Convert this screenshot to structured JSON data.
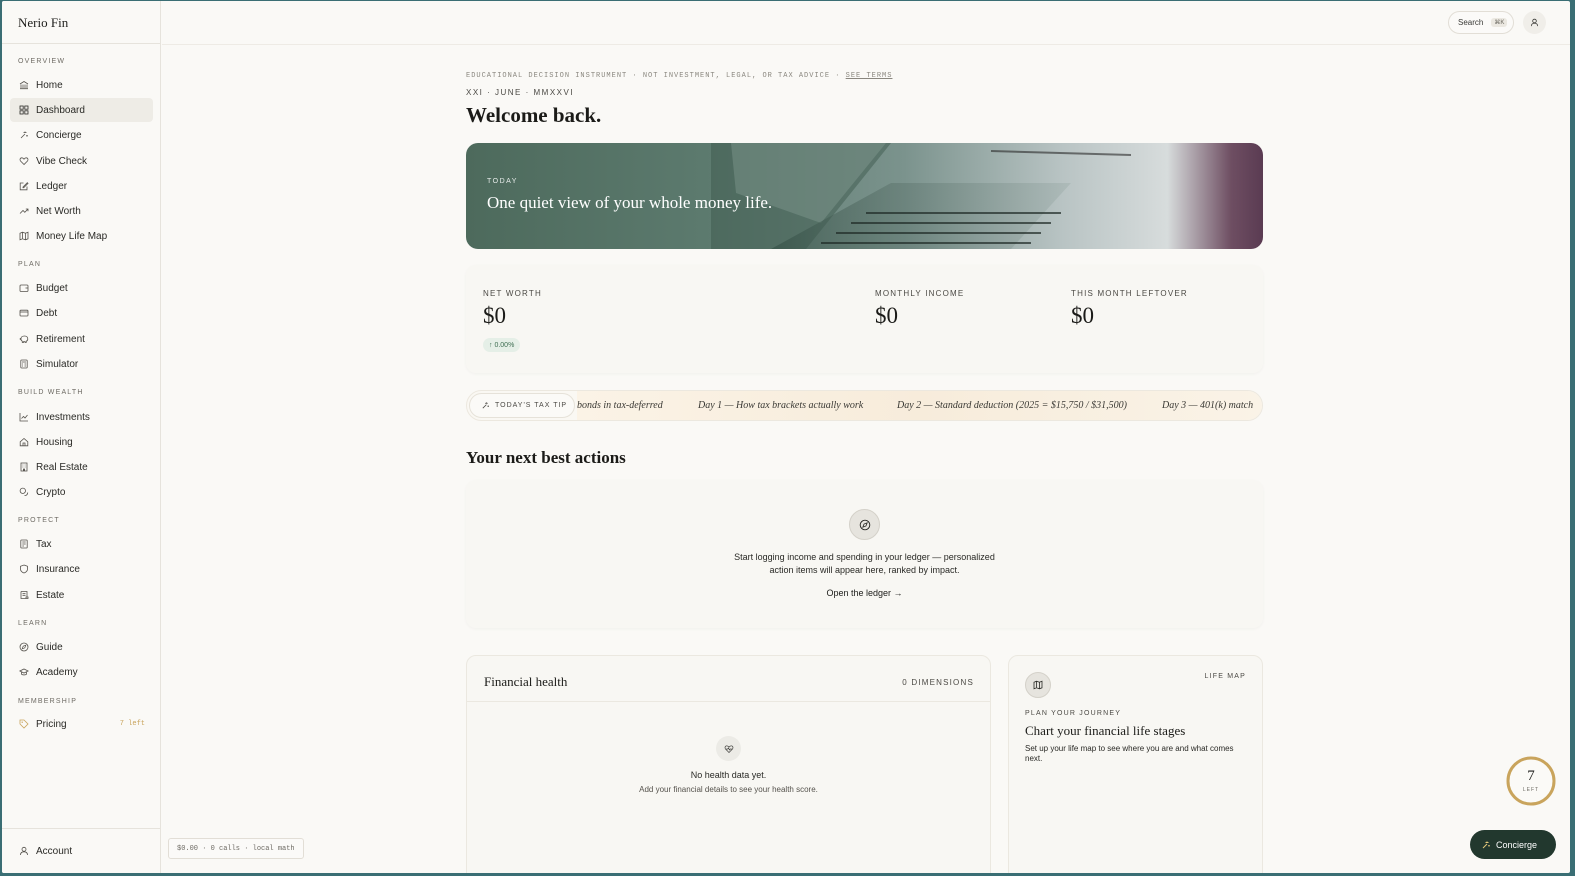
{
  "app": {
    "brand": "Nerio Fin"
  },
  "sidebar": {
    "sections": {
      "overview": "OVERVIEW",
      "plan": "PLAN",
      "build_wealth": "BUILD WEALTH",
      "protect": "PROTECT",
      "learn": "LEARN",
      "membership": "MEMBERSHIP"
    },
    "items": {
      "home": "Home",
      "dashboard": "Dashboard",
      "concierge": "Concierge",
      "vibe_check": "Vibe Check",
      "ledger": "Ledger",
      "net_worth": "Net Worth",
      "money_life_map": "Money Life Map",
      "budget": "Budget",
      "debt": "Debt",
      "retirement": "Retirement",
      "simulator": "Simulator",
      "investments": "Investments",
      "housing": "Housing",
      "real_estate": "Real Estate",
      "crypto": "Crypto",
      "tax": "Tax",
      "insurance": "Insurance",
      "estate": "Estate",
      "guide": "Guide",
      "academy": "Academy",
      "pricing": "Pricing",
      "pricing_badge": "7 left"
    },
    "account": "Account"
  },
  "topbar": {
    "search_label": "Search",
    "search_shortcut": "⌘K"
  },
  "main": {
    "disclaimer": "EDUCATIONAL DECISION INSTRUMENT · NOT INVESTMENT, LEGAL, OR TAX ADVICE · ",
    "see_terms": "SEE TERMS",
    "date_line": "XXI · JUNE · MMXXVI",
    "welcome": "Welcome back.",
    "hero": {
      "eyebrow": "TODAY",
      "title": "One quiet view of your whole money life."
    },
    "stats": {
      "net_worth_label": "NET WORTH",
      "net_worth_value": "$0",
      "net_worth_change": "↑ 0.00%",
      "monthly_income_label": "MONTHLY INCOME",
      "monthly_income_value": "$0",
      "leftover_label": "THIS MONTH LEFTOVER",
      "leftover_value": "$0"
    },
    "tax_tip": {
      "tag": "TODAY'S TAX TIP",
      "items": [
        "bonds in tax-deferred",
        "Day 1 — How tax brackets actually work",
        "Day 2 — Standard deduction (2025 = $15,750 / $31,500)",
        "Day 3 — 401(k) match"
      ]
    },
    "next_actions": {
      "heading": "Your next best actions",
      "line1": "Start logging income and spending in your ledger — personalized",
      "line2": "action items will appear here, ranked by impact.",
      "cta": "Open the ledger →"
    },
    "health": {
      "title": "Financial health",
      "dimensions": "0 DIMENSIONS",
      "empty": "No health data yet.",
      "sub": "Add your financial details to see your health score."
    },
    "life_map": {
      "tag": "LIFE MAP",
      "eyebrow": "PLAN YOUR JOURNEY",
      "title": "Chart your financial life stages",
      "desc": "Set up your life map to see where you are and what comes next."
    }
  },
  "footer": {
    "cost_chip": "$0.00 · 0 calls · local math",
    "remaining": "7",
    "remaining_label": "LEFT",
    "concierge_button": "Concierge"
  },
  "colors": {
    "accent_dark_green": "#22382e",
    "gold_badge": "#c9a45c",
    "positive_green": "#3f6e52"
  }
}
